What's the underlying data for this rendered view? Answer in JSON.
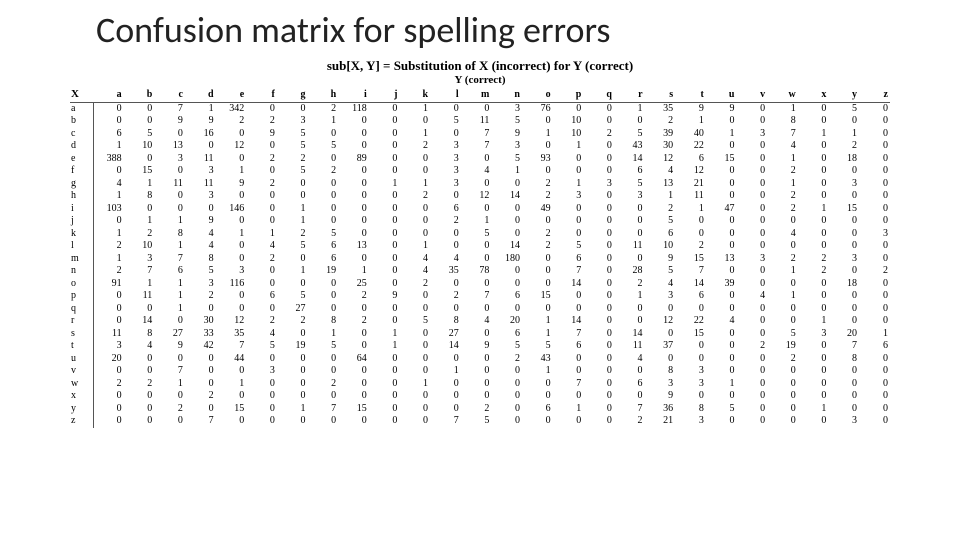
{
  "title": "Confusion matrix for spelling errors",
  "caption": "sub[X, Y] = Substitution of X (incorrect) for Y (correct)",
  "y_caption": "Y (correct)",
  "x_label": "X",
  "letters": [
    "a",
    "b",
    "c",
    "d",
    "e",
    "f",
    "g",
    "h",
    "i",
    "j",
    "k",
    "l",
    "m",
    "n",
    "o",
    "p",
    "q",
    "r",
    "s",
    "t",
    "u",
    "v",
    "w",
    "x",
    "y",
    "z"
  ],
  "matrix": {
    "a": [
      0,
      0,
      7,
      1,
      342,
      0,
      0,
      2,
      118,
      0,
      1,
      0,
      0,
      3,
      76,
      0,
      0,
      1,
      35,
      9,
      9,
      0,
      1,
      0,
      5,
      0
    ],
    "b": [
      0,
      0,
      9,
      9,
      2,
      2,
      3,
      1,
      0,
      0,
      0,
      5,
      11,
      5,
      0,
      10,
      0,
      0,
      2,
      1,
      0,
      0,
      8,
      0,
      0,
      0
    ],
    "c": [
      6,
      5,
      0,
      16,
      0,
      9,
      5,
      0,
      0,
      0,
      1,
      0,
      7,
      9,
      1,
      10,
      2,
      5,
      39,
      40,
      1,
      3,
      7,
      1,
      1,
      0
    ],
    "d": [
      1,
      10,
      13,
      0,
      12,
      0,
      5,
      5,
      0,
      0,
      2,
      3,
      7,
      3,
      0,
      1,
      0,
      43,
      30,
      22,
      0,
      0,
      4,
      0,
      2,
      0
    ],
    "e": [
      388,
      0,
      3,
      11,
      0,
      2,
      2,
      0,
      89,
      0,
      0,
      3,
      0,
      5,
      93,
      0,
      0,
      14,
      12,
      6,
      15,
      0,
      1,
      0,
      18,
      0
    ],
    "f": [
      0,
      15,
      0,
      3,
      1,
      0,
      5,
      2,
      0,
      0,
      0,
      3,
      4,
      1,
      0,
      0,
      0,
      6,
      4,
      12,
      0,
      0,
      2,
      0,
      0,
      0
    ],
    "g": [
      4,
      1,
      11,
      11,
      9,
      2,
      0,
      0,
      0,
      1,
      1,
      3,
      0,
      0,
      2,
      1,
      3,
      5,
      13,
      21,
      0,
      0,
      1,
      0,
      3,
      0
    ],
    "h": [
      1,
      8,
      0,
      3,
      0,
      0,
      0,
      0,
      0,
      0,
      2,
      0,
      12,
      14,
      2,
      3,
      0,
      3,
      1,
      11,
      0,
      0,
      2,
      0,
      0,
      0
    ],
    "i": [
      103,
      0,
      0,
      0,
      146,
      0,
      1,
      0,
      0,
      0,
      0,
      6,
      0,
      0,
      49,
      0,
      0,
      0,
      2,
      1,
      47,
      0,
      2,
      1,
      15,
      0
    ],
    "j": [
      0,
      1,
      1,
      9,
      0,
      0,
      1,
      0,
      0,
      0,
      0,
      2,
      1,
      0,
      0,
      0,
      0,
      0,
      5,
      0,
      0,
      0,
      0,
      0,
      0,
      0
    ],
    "k": [
      1,
      2,
      8,
      4,
      1,
      1,
      2,
      5,
      0,
      0,
      0,
      0,
      5,
      0,
      2,
      0,
      0,
      0,
      6,
      0,
      0,
      0,
      4,
      0,
      0,
      3
    ],
    "l": [
      2,
      10,
      1,
      4,
      0,
      4,
      5,
      6,
      13,
      0,
      1,
      0,
      0,
      14,
      2,
      5,
      0,
      11,
      10,
      2,
      0,
      0,
      0,
      0,
      0,
      0
    ],
    "m": [
      1,
      3,
      7,
      8,
      0,
      2,
      0,
      6,
      0,
      0,
      4,
      4,
      0,
      180,
      0,
      6,
      0,
      0,
      9,
      15,
      13,
      3,
      2,
      2,
      3,
      0
    ],
    "n": [
      2,
      7,
      6,
      5,
      3,
      0,
      1,
      19,
      1,
      0,
      4,
      35,
      78,
      0,
      0,
      7,
      0,
      28,
      5,
      7,
      0,
      0,
      1,
      2,
      0,
      2
    ],
    "o": [
      91,
      1,
      1,
      3,
      116,
      0,
      0,
      0,
      25,
      0,
      2,
      0,
      0,
      0,
      0,
      14,
      0,
      2,
      4,
      14,
      39,
      0,
      0,
      0,
      18,
      0
    ],
    "p": [
      0,
      11,
      1,
      2,
      0,
      6,
      5,
      0,
      2,
      9,
      0,
      2,
      7,
      6,
      15,
      0,
      0,
      1,
      3,
      6,
      0,
      4,
      1,
      0,
      0,
      0
    ],
    "q": [
      0,
      0,
      1,
      0,
      0,
      0,
      27,
      0,
      0,
      0,
      0,
      0,
      0,
      0,
      0,
      0,
      0,
      0,
      0,
      0,
      0,
      0,
      0,
      0,
      0,
      0
    ],
    "r": [
      0,
      14,
      0,
      30,
      12,
      2,
      2,
      8,
      2,
      0,
      5,
      8,
      4,
      20,
      1,
      14,
      0,
      0,
      12,
      22,
      4,
      0,
      0,
      1,
      0,
      0
    ],
    "s": [
      11,
      8,
      27,
      33,
      35,
      4,
      0,
      1,
      0,
      1,
      0,
      27,
      0,
      6,
      1,
      7,
      0,
      14,
      0,
      15,
      0,
      0,
      5,
      3,
      20,
      1
    ],
    "t": [
      3,
      4,
      9,
      42,
      7,
      5,
      19,
      5,
      0,
      1,
      0,
      14,
      9,
      5,
      5,
      6,
      0,
      11,
      37,
      0,
      0,
      2,
      19,
      0,
      7,
      6
    ],
    "u": [
      20,
      0,
      0,
      0,
      44,
      0,
      0,
      0,
      64,
      0,
      0,
      0,
      0,
      2,
      43,
      0,
      0,
      4,
      0,
      0,
      0,
      0,
      2,
      0,
      8,
      0
    ],
    "v": [
      0,
      0,
      7,
      0,
      0,
      3,
      0,
      0,
      0,
      0,
      0,
      1,
      0,
      0,
      1,
      0,
      0,
      0,
      8,
      3,
      0,
      0,
      0,
      0,
      0,
      0
    ],
    "w": [
      2,
      2,
      1,
      0,
      1,
      0,
      0,
      2,
      0,
      0,
      1,
      0,
      0,
      0,
      0,
      7,
      0,
      6,
      3,
      3,
      1,
      0,
      0,
      0,
      0,
      0
    ],
    "x": [
      0,
      0,
      0,
      2,
      0,
      0,
      0,
      0,
      0,
      0,
      0,
      0,
      0,
      0,
      0,
      0,
      0,
      0,
      9,
      0,
      0,
      0,
      0,
      0,
      0,
      0
    ],
    "y": [
      0,
      0,
      2,
      0,
      15,
      0,
      1,
      7,
      15,
      0,
      0,
      0,
      2,
      0,
      6,
      1,
      0,
      7,
      36,
      8,
      5,
      0,
      0,
      1,
      0,
      0
    ],
    "z": [
      0,
      0,
      0,
      7,
      0,
      0,
      0,
      0,
      0,
      0,
      0,
      7,
      5,
      0,
      0,
      0,
      0,
      2,
      21,
      3,
      0,
      0,
      0,
      0,
      3,
      0
    ]
  }
}
